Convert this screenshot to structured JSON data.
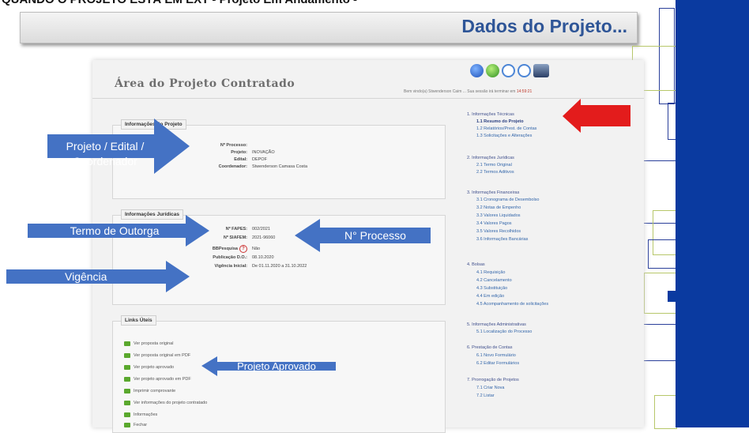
{
  "slide": {
    "heading": "QUANDO O PROJETO ESTÁ EM EXT - Projeto Em Andamento -",
    "banner_title": "Dados do Projeto..."
  },
  "app": {
    "title": "Área do Projeto Contratado",
    "welcome": "Bem vindo(a) Stwenderson Caim ... Sua sessão irá terminar em",
    "session_time": "14:59:21",
    "toolbar_icons": [
      "back-icon",
      "check-icon",
      "zoom-in-icon",
      "zoom-out-icon",
      "print-icon"
    ]
  },
  "project_info": {
    "legend": "Informações do Projeto",
    "fields": [
      {
        "label": "Nº Processo:",
        "value": ""
      },
      {
        "label": "Projeto:",
        "value": "INOVAÇÃO"
      },
      {
        "label": "Edital:",
        "value": "DEPOF"
      },
      {
        "label": "Coordenador:",
        "value": "Stwenderson Camasa Costa"
      }
    ]
  },
  "legal_info": {
    "legend": "Informações Jurídicas",
    "fields": [
      {
        "label": "Nº FAPES:",
        "value": "002/2021"
      },
      {
        "label": "Nº SIAFEM:",
        "value": "2021-96060"
      },
      {
        "label": "BBPesquisa",
        "value": "Não"
      },
      {
        "label": "Publicação D.O.:",
        "value": "08.10.2020"
      },
      {
        "label": "Vigência Inicial:",
        "value": "De 01.11.2020 a 31.10.2022"
      }
    ]
  },
  "useful_links": {
    "legend": "Links Úteis",
    "items": [
      "Ver proposta original",
      "Ver proposta original em PDF",
      "Ver projeto aprovado",
      "Ver projeto aprovado em PDF",
      "Imprimir comprovante",
      "Ver informações do projeto contratado",
      "Informações",
      "Fechar"
    ]
  },
  "menu": [
    {
      "title": "1. Informações Técnicas",
      "items": [
        "1.1 Resumo do Projeto",
        "1.2 Relatórios/Prest. de Contas",
        "1.3 Solicitações e Alterações"
      ]
    },
    {
      "title": "2. Informações Jurídicas",
      "items": [
        "2.1 Termo Original",
        "2.2 Termos Aditivos"
      ]
    },
    {
      "title": "3. Informações Financeiras",
      "items": [
        "3.1 Cronograma de Desembolso",
        "3.2 Notas de Empenho",
        "3.3 Valores Liquidados",
        "3.4 Valores Pagos",
        "3.5 Valores Recolhidos",
        "3.6 Informações Bancárias"
      ]
    },
    {
      "title": "4. Bolsas",
      "items": [
        "4.1 Requisição",
        "4.2 Cancelamento",
        "4.3 Substituição",
        "4.4 Em edição",
        "4.5 Acompanhamento de solicitações"
      ]
    },
    {
      "title": "5. Informações Administrativas",
      "items": [
        "5.1 Localização do Processo"
      ]
    },
    {
      "title": "6. Prestação de Contas",
      "items": [
        "6.1 Novo Formulário",
        "6.2 Editar Formulários"
      ]
    },
    {
      "title": "7. Prorrogação de Projetos",
      "items": [
        "7.1 Criar Nova",
        "7.2 Listar"
      ]
    }
  ],
  "callouts": {
    "projeto": "Projeto / Edital / Coordenador",
    "termo": "Termo de Outorga",
    "processo": "N° Processo",
    "vigencia": "Vigência",
    "aprovado": "Projeto Aprovado"
  },
  "colors": {
    "callout_blue": "#4472c4",
    "highlight_red": "#e31c1c",
    "panel_blue": "#0a3aa0",
    "banner_text": "#2e5597"
  }
}
